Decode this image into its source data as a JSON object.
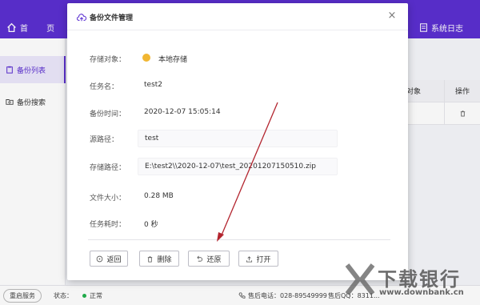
{
  "topbar": {
    "home_label": "首 页",
    "syslog_label": "系统日志"
  },
  "sidebar": {
    "items": [
      {
        "label": "备份列表"
      },
      {
        "label": "备份搜索"
      }
    ]
  },
  "bg_table": {
    "col_object": "对象",
    "col_action": "操作"
  },
  "dialog": {
    "title": "备份文件管理",
    "close": "×",
    "fields": [
      {
        "label": "存储对象：",
        "value": "本地存储"
      },
      {
        "label": "任务名：",
        "value": "test2"
      },
      {
        "label": "备份时间：",
        "value": "2020-12-07 15:05:14"
      },
      {
        "label": "源路径：",
        "value": "test"
      },
      {
        "label": "存储路径：",
        "value": "E:\\test2\\\\2020-12-07\\test_20201207150510.zip"
      },
      {
        "label": "文件大小：",
        "value": "0.28 MB"
      },
      {
        "label": "任务耗时：",
        "value": "0 秒"
      }
    ],
    "buttons": {
      "back": "返回",
      "delete": "删除",
      "restore": "还原",
      "open": "打开"
    }
  },
  "statusbar": {
    "restart_label": "重启服务",
    "state_label": "状态：",
    "state_value": "正常",
    "phone": "售后电话：028-89549999",
    "qq": "售后QQ：8311..."
  },
  "watermark": {
    "big": "下载银行",
    "small": "www.downbank.cn"
  },
  "colors": {
    "brand": "#5b2fd1",
    "status_ok": "#22b14c",
    "storage": "#f1b632",
    "arrow": "#b3252f"
  }
}
